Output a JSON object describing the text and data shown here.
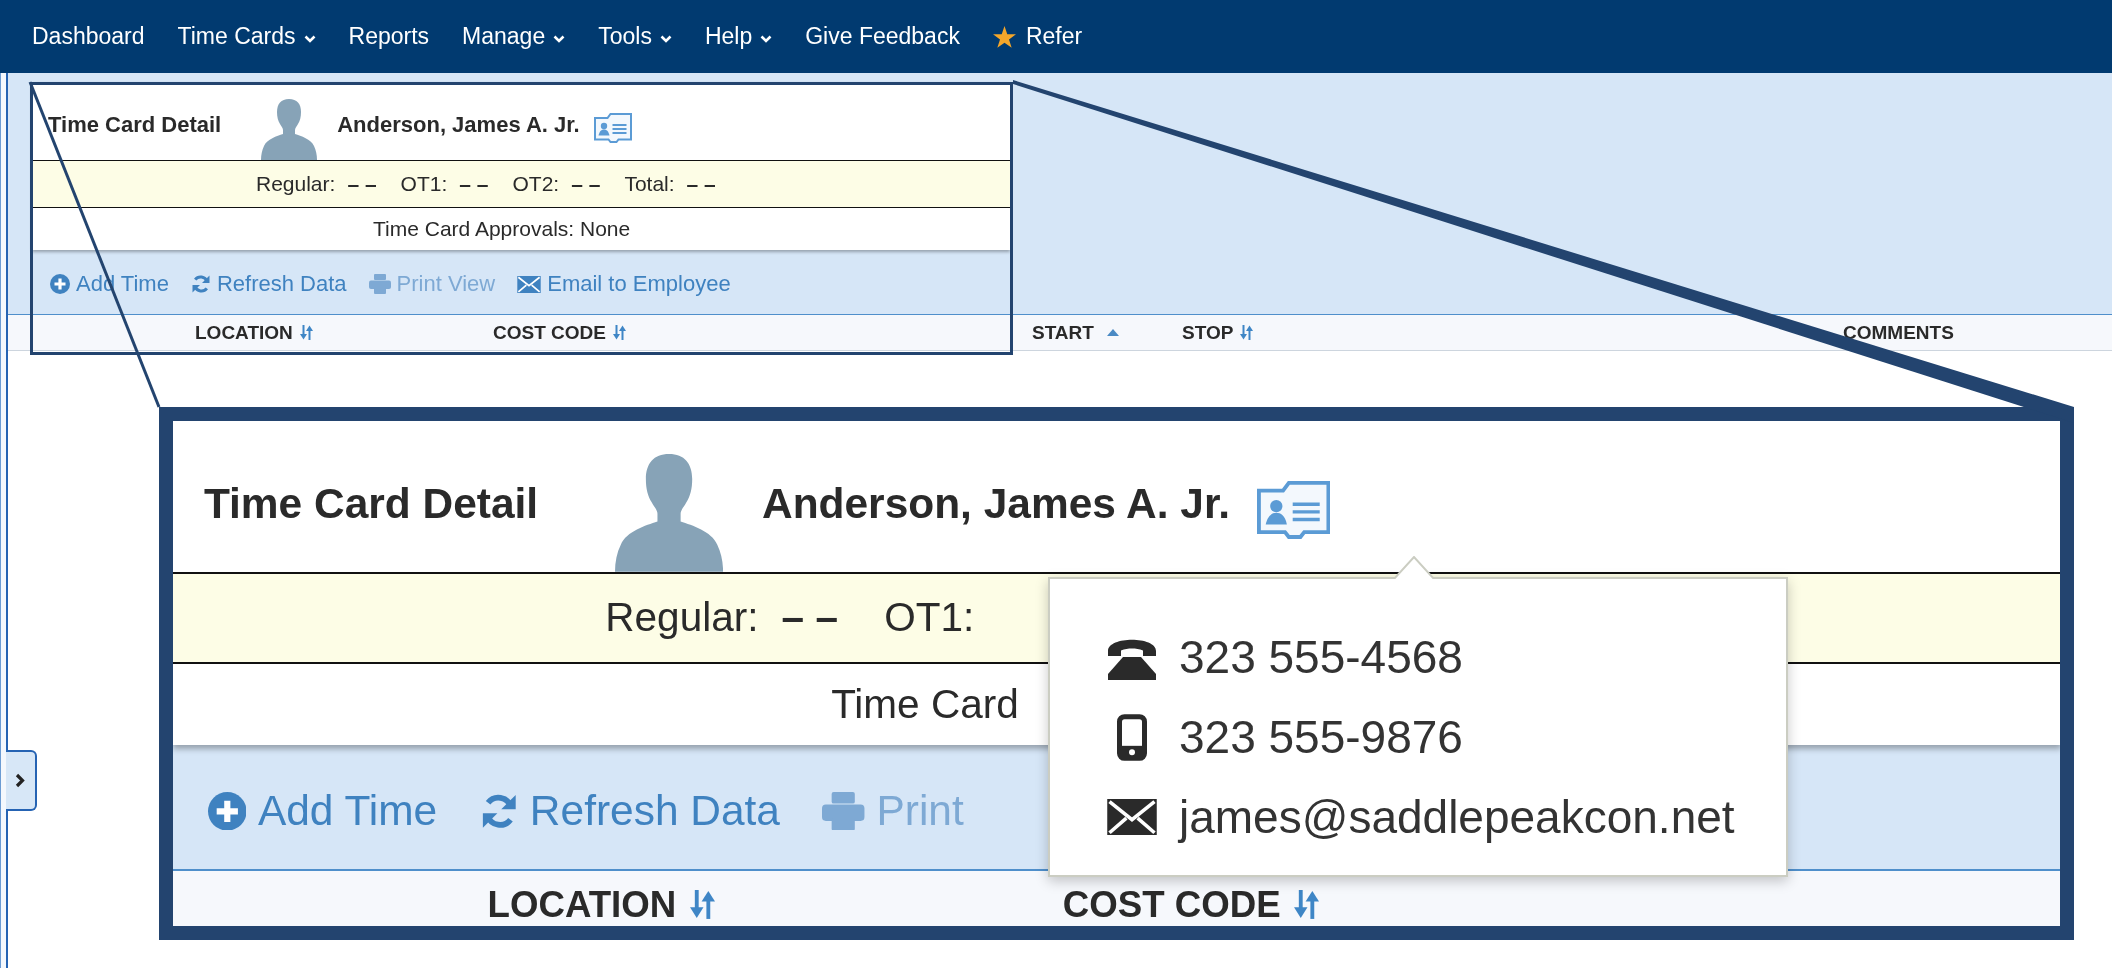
{
  "nav": {
    "items": [
      {
        "label": "Dashboard",
        "dropdown": false,
        "starred": false
      },
      {
        "label": "Time Cards",
        "dropdown": true,
        "starred": false
      },
      {
        "label": "Reports",
        "dropdown": false,
        "starred": false
      },
      {
        "label": "Manage",
        "dropdown": true,
        "starred": false
      },
      {
        "label": "Tools",
        "dropdown": true,
        "starred": false
      },
      {
        "label": "Help",
        "dropdown": true,
        "starred": false
      },
      {
        "label": "Give Feedback",
        "dropdown": false,
        "starred": false
      },
      {
        "label": "Refer",
        "dropdown": false,
        "starred": true
      }
    ]
  },
  "sidebar_toggle": {
    "expanded": false
  },
  "time_card": {
    "title": "Time Card Detail",
    "employee": "Anderson, James A. Jr.",
    "totals": [
      {
        "label": "Regular:",
        "value": "– –"
      },
      {
        "label": "OT1:",
        "value": "– –"
      },
      {
        "label": "OT2:",
        "value": "– –"
      },
      {
        "label": "Total:",
        "value": "– –"
      }
    ],
    "approvals": "Time Card Approvals: None",
    "actions": [
      {
        "kind": "add",
        "label": "Add Time",
        "disabled": false
      },
      {
        "kind": "refresh",
        "label": "Refresh Data",
        "disabled": false
      },
      {
        "kind": "print",
        "label": "Print View",
        "disabled": true
      },
      {
        "kind": "email",
        "label": "Email to Employee",
        "disabled": false
      }
    ],
    "columns": [
      {
        "label": "LOCATION",
        "sortable": true,
        "sorted": false
      },
      {
        "label": "COST CODE",
        "sortable": true,
        "sorted": false
      },
      {
        "label": "START",
        "sortable": true,
        "sorted": true
      },
      {
        "label": "STOP",
        "sortable": true,
        "sorted": false
      },
      {
        "label": "COMMENTS",
        "sortable": false,
        "sorted": false
      }
    ]
  },
  "magnified_inset": {
    "title": "Time Card Detail",
    "employee": "Anderson, James A. Jr.",
    "totals": [
      {
        "label": "Regular:",
        "value": "– –"
      },
      {
        "label": "OT1:"
      }
    ],
    "approvals": "Time Card",
    "actions": [
      {
        "kind": "add",
        "label": "Add Time",
        "disabled": false
      },
      {
        "kind": "refresh",
        "label": "Refresh Data",
        "disabled": false
      },
      {
        "kind": "print",
        "label": "Print",
        "disabled": true
      }
    ],
    "columns": [
      {
        "label": "LOCATION",
        "sortable": true,
        "sorted": false
      },
      {
        "label": "COST CODE",
        "sortable": true,
        "sorted": false
      }
    ],
    "contact_popup": [
      {
        "kind": "phone",
        "text": "323 555-4568"
      },
      {
        "kind": "mobile",
        "text": "323 555-9876"
      },
      {
        "kind": "email",
        "text": "james@saddlepeakcon.net"
      }
    ]
  }
}
